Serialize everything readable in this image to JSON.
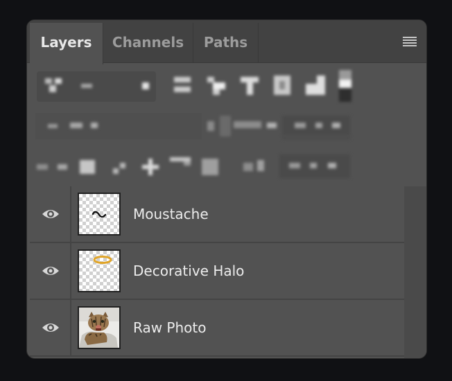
{
  "panel": {
    "tabs": [
      {
        "label": "Layers",
        "active": true
      },
      {
        "label": "Channels",
        "active": false
      },
      {
        "label": "Paths",
        "active": false
      }
    ],
    "menu_icon": "hamburger-menu-icon"
  },
  "layers": [
    {
      "name": "Moustache",
      "visible": true,
      "thumbnail": "moustache-thumbnail"
    },
    {
      "name": "Decorative Halo",
      "visible": true,
      "thumbnail": "halo-thumbnail"
    },
    {
      "name": "Raw Photo",
      "visible": true,
      "thumbnail": "cat-photo-thumbnail"
    }
  ],
  "colors": {
    "panel_bg": "#525252",
    "tab_bar_bg": "#424242",
    "halo_gold": "#e0a52a",
    "page_bg": "#101114"
  }
}
